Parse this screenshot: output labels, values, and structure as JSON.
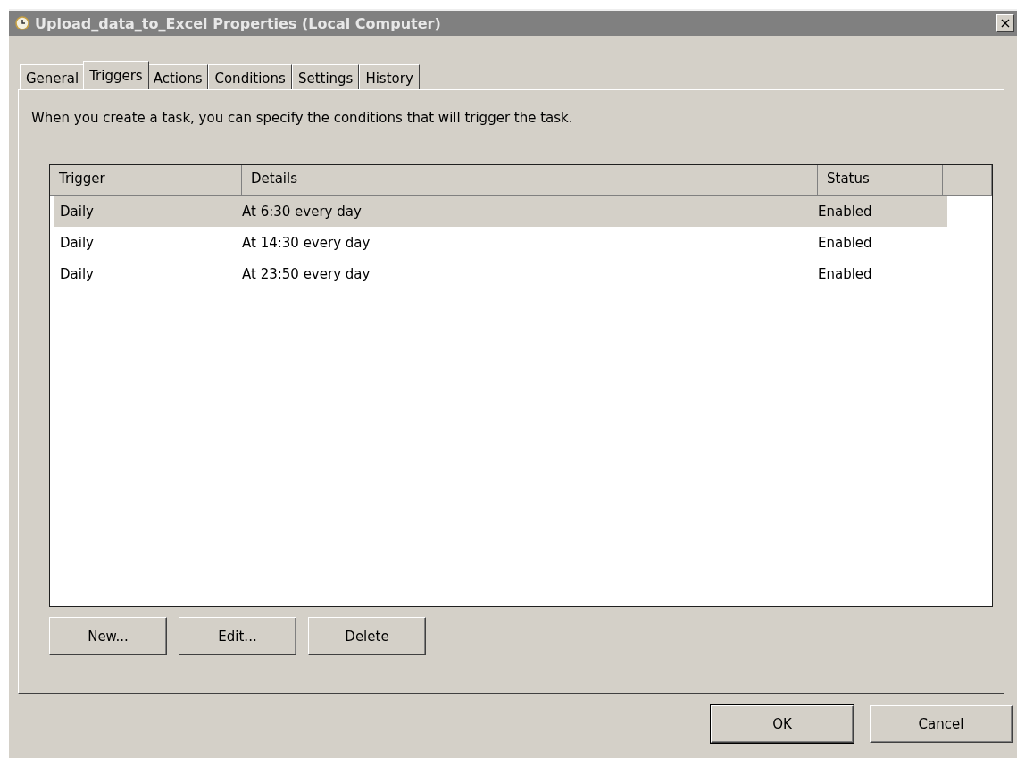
{
  "window": {
    "title": "Upload_data_to_Excel Properties (Local Computer)",
    "close": "×"
  },
  "tabs": [
    {
      "label": "General",
      "selected": false
    },
    {
      "label": "Triggers",
      "selected": true
    },
    {
      "label": "Actions",
      "selected": false
    },
    {
      "label": "Conditions",
      "selected": false
    },
    {
      "label": "Settings",
      "selected": false
    },
    {
      "label": "History",
      "selected": false
    }
  ],
  "description": "When you create a task, you can specify the conditions that will trigger the task.",
  "table": {
    "columns": [
      "Trigger",
      "Details",
      "Status"
    ],
    "rows": [
      {
        "cells": [
          "Daily",
          "At 6:30 every day",
          "Enabled"
        ],
        "selected": true
      },
      {
        "cells": [
          "Daily",
          "At 14:30 every day",
          "Enabled"
        ],
        "selected": false
      },
      {
        "cells": [
          "Daily",
          "At 23:50 every day",
          "Enabled"
        ],
        "selected": false
      }
    ]
  },
  "list_buttons": [
    "New...",
    "Edit...",
    "Delete"
  ],
  "dialog_buttons": [
    {
      "label": "OK",
      "default": true
    },
    {
      "label": "Cancel",
      "default": false
    }
  ]
}
